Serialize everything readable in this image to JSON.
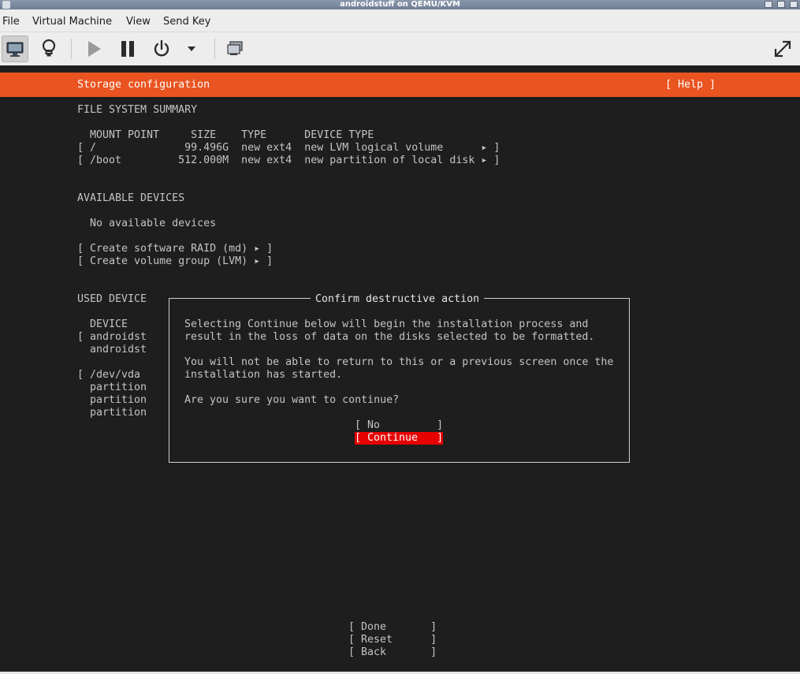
{
  "window": {
    "title": "androidstuff on QEMU/KVM"
  },
  "menubar": {
    "items": [
      "File",
      "Virtual Machine",
      "View",
      "Send Key"
    ]
  },
  "toolbar": {
    "icons": [
      "monitor-icon",
      "lightbulb-icon",
      "play-icon",
      "pause-icon",
      "power-icon",
      "dropdown-arrow-icon",
      "snapshot-icon",
      "fullscreen-icon"
    ]
  },
  "screen": {
    "header": {
      "title": "Storage configuration",
      "help": "[ Help ]"
    },
    "fs_summary": {
      "heading": "FILE SYSTEM SUMMARY",
      "columns_line": "MOUNT POINT     SIZE    TYPE      DEVICE TYPE",
      "rows": [
        "[ /              99.496G  new ext4  new LVM logical volume      ▸ ]",
        "[ /boot         512.000M  new ext4  new partition of local disk ▸ ]"
      ]
    },
    "available": {
      "heading": "AVAILABLE DEVICES",
      "none": "No available devices",
      "actions": [
        "[ Create software RAID (md) ▸ ]",
        "[ Create volume group (LVM) ▸ ]"
      ]
    },
    "used": {
      "heading": "USED DEVICE",
      "lines": [
        "  DEVICE",
        "[ androidst",
        "  androidst",
        "",
        "[ /dev/vda",
        "  partition",
        "  partition",
        "  partition"
      ]
    },
    "dialog": {
      "title": "Confirm destructive action",
      "lines": [
        "Selecting Continue below will begin the installation process and",
        "result in the loss of data on the disks selected to be formatted.",
        "",
        "You will not be able to return to this or a previous screen once the",
        "installation has started.",
        "",
        "Are you sure you want to continue?"
      ],
      "no_button": "[ No         ]",
      "continue_button": "[ Continue   ]"
    },
    "bottom_buttons": {
      "done": "[ Done       ]",
      "reset": "[ Reset      ]",
      "back": "[ Back       ]"
    }
  },
  "colors": {
    "header_orange": "#e95420",
    "terminal_bg": "#1e1e1e",
    "terminal_text": "#c4c4c4",
    "focus_red": "#e60000"
  }
}
